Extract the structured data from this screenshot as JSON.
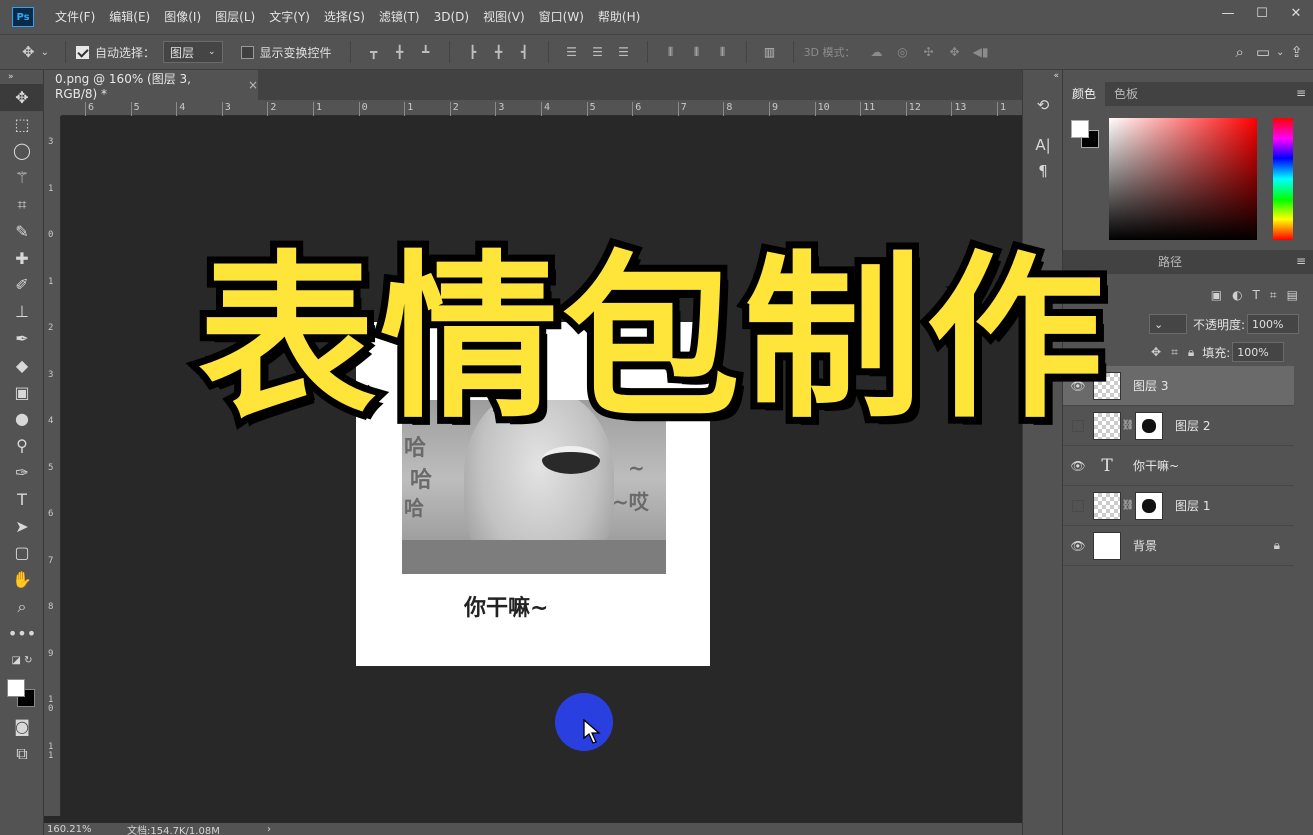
{
  "app": {
    "logo": "Ps"
  },
  "menu": [
    "文件(F)",
    "编辑(E)",
    "图像(I)",
    "图层(L)",
    "文字(Y)",
    "选择(S)",
    "滤镜(T)",
    "3D(D)",
    "视图(V)",
    "窗口(W)",
    "帮助(H)"
  ],
  "window_controls": {
    "minimize": "—",
    "maximize": "☐",
    "close": "✕"
  },
  "options": {
    "auto_select_label": "自动选择：",
    "auto_select_checked": true,
    "auto_select_value": "图层",
    "show_transform_label": "显示变换控件",
    "show_transform_checked": false,
    "mode_3d_label": "3D 模式："
  },
  "document": {
    "tab_title": "0.png @ 160% (图层 3, RGB/8) *",
    "tab_close": "×",
    "ruler_top": [
      "6",
      "5",
      "4",
      "3",
      "2",
      "1",
      "0",
      "1",
      "2",
      "3",
      "4",
      "5",
      "6",
      "7",
      "8",
      "9",
      "10",
      "11",
      "12",
      "13",
      "1"
    ],
    "ruler_left": [
      "3",
      "1",
      "0",
      "1",
      "2",
      "3",
      "4",
      "5",
      "6",
      "7",
      "8",
      "9",
      "10",
      "11"
    ],
    "zoom": "160.21%",
    "doc_info": "文档:154.7K/1.08M",
    "status_arrow": "›"
  },
  "artwork": {
    "title_overlay": "表情包制作",
    "caption": "你干嘛~",
    "photo_texts": [
      "哈",
      "哈",
      "哈",
      "~",
      "~哎"
    ]
  },
  "color_panel": {
    "tabs": [
      "颜色",
      "色板"
    ],
    "fg_color": "#ffffff",
    "bg_color": "#000000"
  },
  "layers_panel": {
    "tabs": [
      "路径"
    ],
    "opacity_label": "不透明度:",
    "opacity_value": "100%",
    "fill_label": "填充:",
    "fill_value": "100%",
    "layers": [
      {
        "name": "图层 3",
        "type": "image",
        "selected": true,
        "visible": true
      },
      {
        "name": "图层 2",
        "type": "masked",
        "visible": false
      },
      {
        "name": "你干嘛~",
        "type": "text",
        "visible": true
      },
      {
        "name": "图层 1",
        "type": "masked",
        "visible": false
      },
      {
        "name": "背景",
        "type": "background",
        "visible": true,
        "locked": true
      }
    ]
  },
  "colors": {
    "title_yellow": "#ffe53a",
    "cursor_blue": "#2a3fe0"
  }
}
